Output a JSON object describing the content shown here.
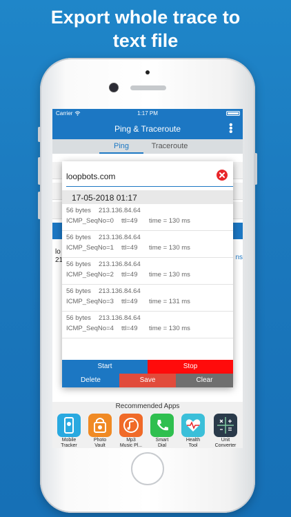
{
  "headline": [
    "Export whole trace to",
    "text file"
  ],
  "status_bar": {
    "carrier": "Carrier",
    "time": "1:17 PM"
  },
  "navbar": {
    "title": "Ping & Traceroute",
    "menu_icon": "more-vertical-icon"
  },
  "tabs": [
    {
      "label": "Ping",
      "active": true
    },
    {
      "label": "Traceroute",
      "active": false
    }
  ],
  "background": {
    "text": "lo\n21",
    "link": "ns"
  },
  "dialog": {
    "host": "loopbots.com",
    "close_icon": "close-circle-icon",
    "date": "17-05-2018 01:17",
    "results": [
      {
        "bytes": "56 bytes",
        "ip": "213.136.84.64",
        "seq": "ICMP_SeqNo=0",
        "ttl": "ttl=49",
        "time": "time = 130 ms"
      },
      {
        "bytes": "56 bytes",
        "ip": "213.136.84.64",
        "seq": "ICMP_SeqNo=1",
        "ttl": "ttl=49",
        "time": "time = 130 ms"
      },
      {
        "bytes": "56 bytes",
        "ip": "213.136.84.64",
        "seq": "ICMP_SeqNo=2",
        "ttl": "ttl=49",
        "time": "time = 130 ms"
      },
      {
        "bytes": "56 bytes",
        "ip": "213.136.84.64",
        "seq": "ICMP_SeqNo=3",
        "ttl": "ttl=49",
        "time": "time = 131 ms"
      },
      {
        "bytes": "56 bytes",
        "ip": "213.136.84.64",
        "seq": "ICMP_SeqNo=4",
        "ttl": "ttl=49",
        "time": "time = 130 ms"
      }
    ],
    "buttons": {
      "start": "Start",
      "stop": "Stop",
      "delete": "Delete",
      "save": "Save",
      "clear": "Clear"
    }
  },
  "recommended": {
    "title": "Recommended Apps",
    "apps": [
      {
        "name": "Mobile Tracker",
        "lines": [
          "Mobile",
          "Tracker"
        ],
        "color": "#29a9e0"
      },
      {
        "name": "Photo Vault",
        "lines": [
          "Photo",
          "Vault"
        ],
        "color": "#f08a24"
      },
      {
        "name": "Mp3 Music Player",
        "lines": [
          "Mp3",
          "Music Pl..."
        ],
        "color": "#f06a28"
      },
      {
        "name": "Smart Dial",
        "lines": [
          "Smart",
          "Dial"
        ],
        "color": "#2fbf4f"
      },
      {
        "name": "Health Tool",
        "lines": [
          "Health",
          "Tool"
        ],
        "color": "#3bbfd9"
      },
      {
        "name": "Unit Converter",
        "lines": [
          "Unit",
          "Converter"
        ],
        "color": "#2a3a4a"
      }
    ]
  },
  "colors": {
    "accent": "#1c77c3",
    "stop": "#ff0b0b",
    "save": "#e14b3b",
    "clear": "#6f6f6f",
    "start": "#1c77c3"
  }
}
